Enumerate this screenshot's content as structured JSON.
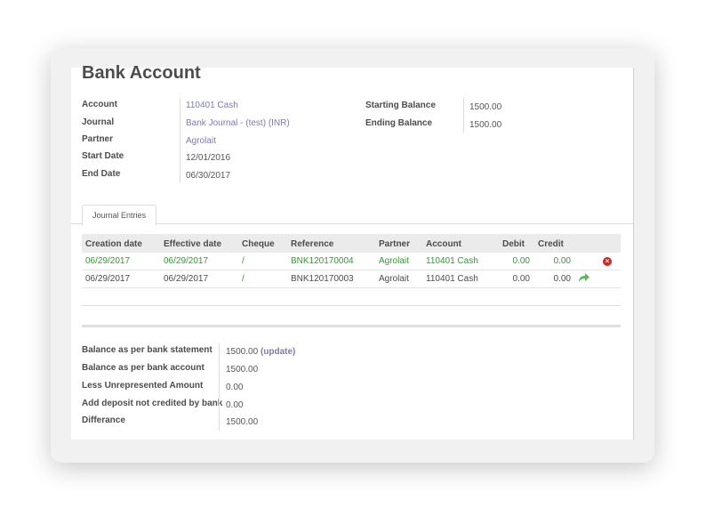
{
  "header": {
    "title": "Bank Account"
  },
  "left_fields": [
    {
      "label": "Account",
      "value": "110401 Cash",
      "link": true
    },
    {
      "label": "Journal",
      "value": "Bank Journal - (test) (INR)",
      "link": true
    },
    {
      "label": "Partner",
      "value": "Agrolait",
      "link": true
    },
    {
      "label": "Start Date",
      "value": "12/01/2016",
      "link": false
    },
    {
      "label": "End Date",
      "value": "06/30/2017",
      "link": false
    }
  ],
  "right_fields": [
    {
      "label": "Starting Balance",
      "value": "1500.00"
    },
    {
      "label": "Ending Balance",
      "value": "1500.00"
    }
  ],
  "tabs": [
    {
      "label": "Journal Entries"
    }
  ],
  "table": {
    "columns": [
      "Creation date",
      "Effective date",
      "Cheque",
      "Reference",
      "Partner",
      "Account",
      "Debit",
      "Credit"
    ],
    "rows": [
      {
        "creation": "06/29/2017",
        "effective": "06/29/2017",
        "cheque": "/",
        "reference": "BNK120170004",
        "partner": "Agrolait",
        "account": "110401 Cash",
        "debit": "0.00",
        "credit": "0.00",
        "highlight": true,
        "action_icon": "delete-icon"
      },
      {
        "creation": "06/29/2017",
        "effective": "06/29/2017",
        "cheque": "/",
        "reference": "BNK120170003",
        "partner": "Agrolait",
        "account": "110401 Cash",
        "debit": "0.00",
        "credit": "0.00",
        "highlight": false,
        "action_icon": "reconcile-arrow-icon"
      }
    ]
  },
  "summary": [
    {
      "label": "Balance as per bank statement",
      "value": "1500.00",
      "action": "(update)"
    },
    {
      "label": "Balance as per bank account",
      "value": "1500.00"
    },
    {
      "label": "Less Unrepresented Amount",
      "value": "0.00"
    },
    {
      "label": "Add deposit not credited by bank",
      "value": "0.00"
    },
    {
      "label": "Differance",
      "value": "1500.00"
    }
  ],
  "colors": {
    "link": "#7c7bad",
    "highlight_row": "#2e9b2e",
    "delete": "#d62424",
    "reconcile": "#5cb85c"
  }
}
